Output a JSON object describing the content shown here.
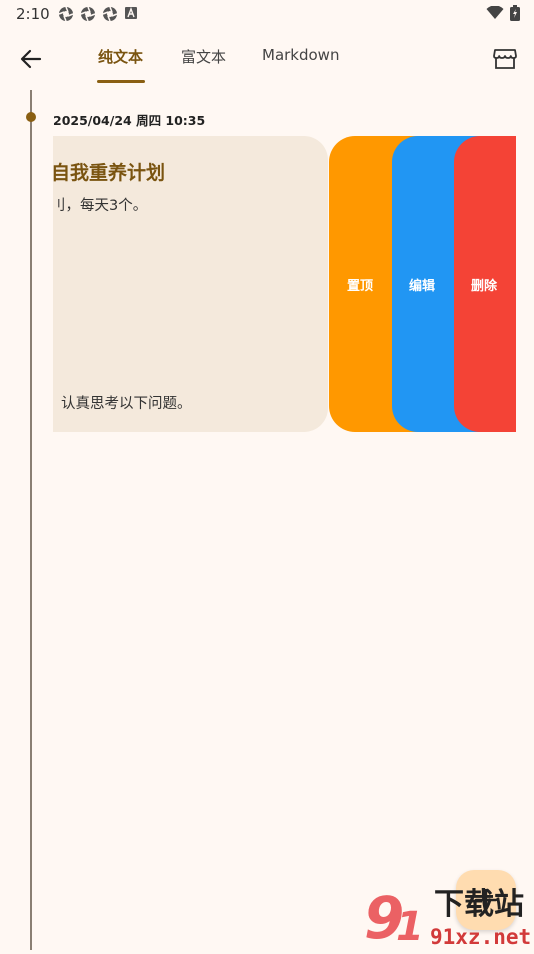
{
  "status_bar": {
    "time": "2:10"
  },
  "top_bar": {
    "tabs": [
      {
        "label": "纯文本",
        "active": true
      },
      {
        "label": "富文本",
        "active": false
      },
      {
        "label": "Markdown",
        "active": false
      }
    ]
  },
  "entry": {
    "date": "2025/04/24 周四 10:35",
    "title": "自我重养计划",
    "line1": "刂，每天3个。",
    "line2": "认真思考以下问题。"
  },
  "actions": {
    "pin": "置顶",
    "edit": "编辑",
    "delete": "删除"
  },
  "colors": {
    "background": "#fff8f3",
    "accent": "#8a5f12",
    "card": "#f4e9dc",
    "pin": "#ff9800",
    "edit": "#2196f3",
    "delete": "#f44336",
    "fab": "#ffdcb0"
  },
  "watermark": {
    "brand": "下载站",
    "site": "91xz.net"
  }
}
